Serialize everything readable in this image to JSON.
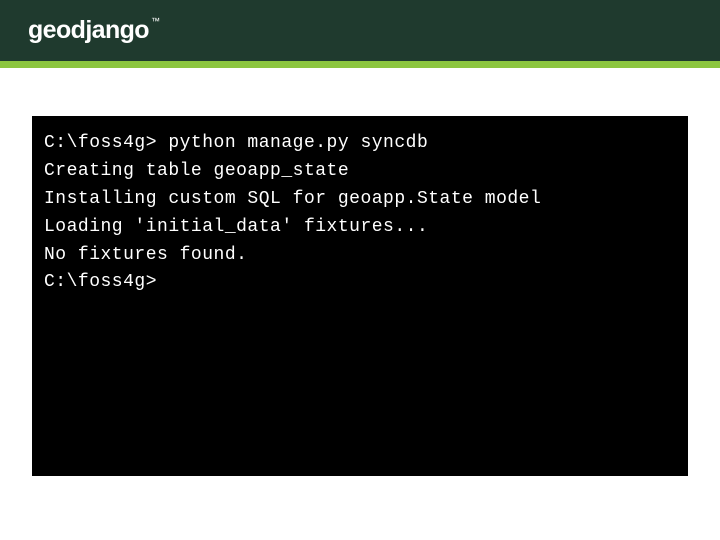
{
  "header": {
    "logo_text": "geodjango",
    "trademark": "™"
  },
  "terminal": {
    "lines": [
      "C:\\foss4g> python manage.py syncdb",
      "Creating table geoapp_state",
      "Installing custom SQL for geoapp.State model",
      "Loading 'initial_data' fixtures...",
      "No fixtures found.",
      "C:\\foss4g>"
    ]
  }
}
